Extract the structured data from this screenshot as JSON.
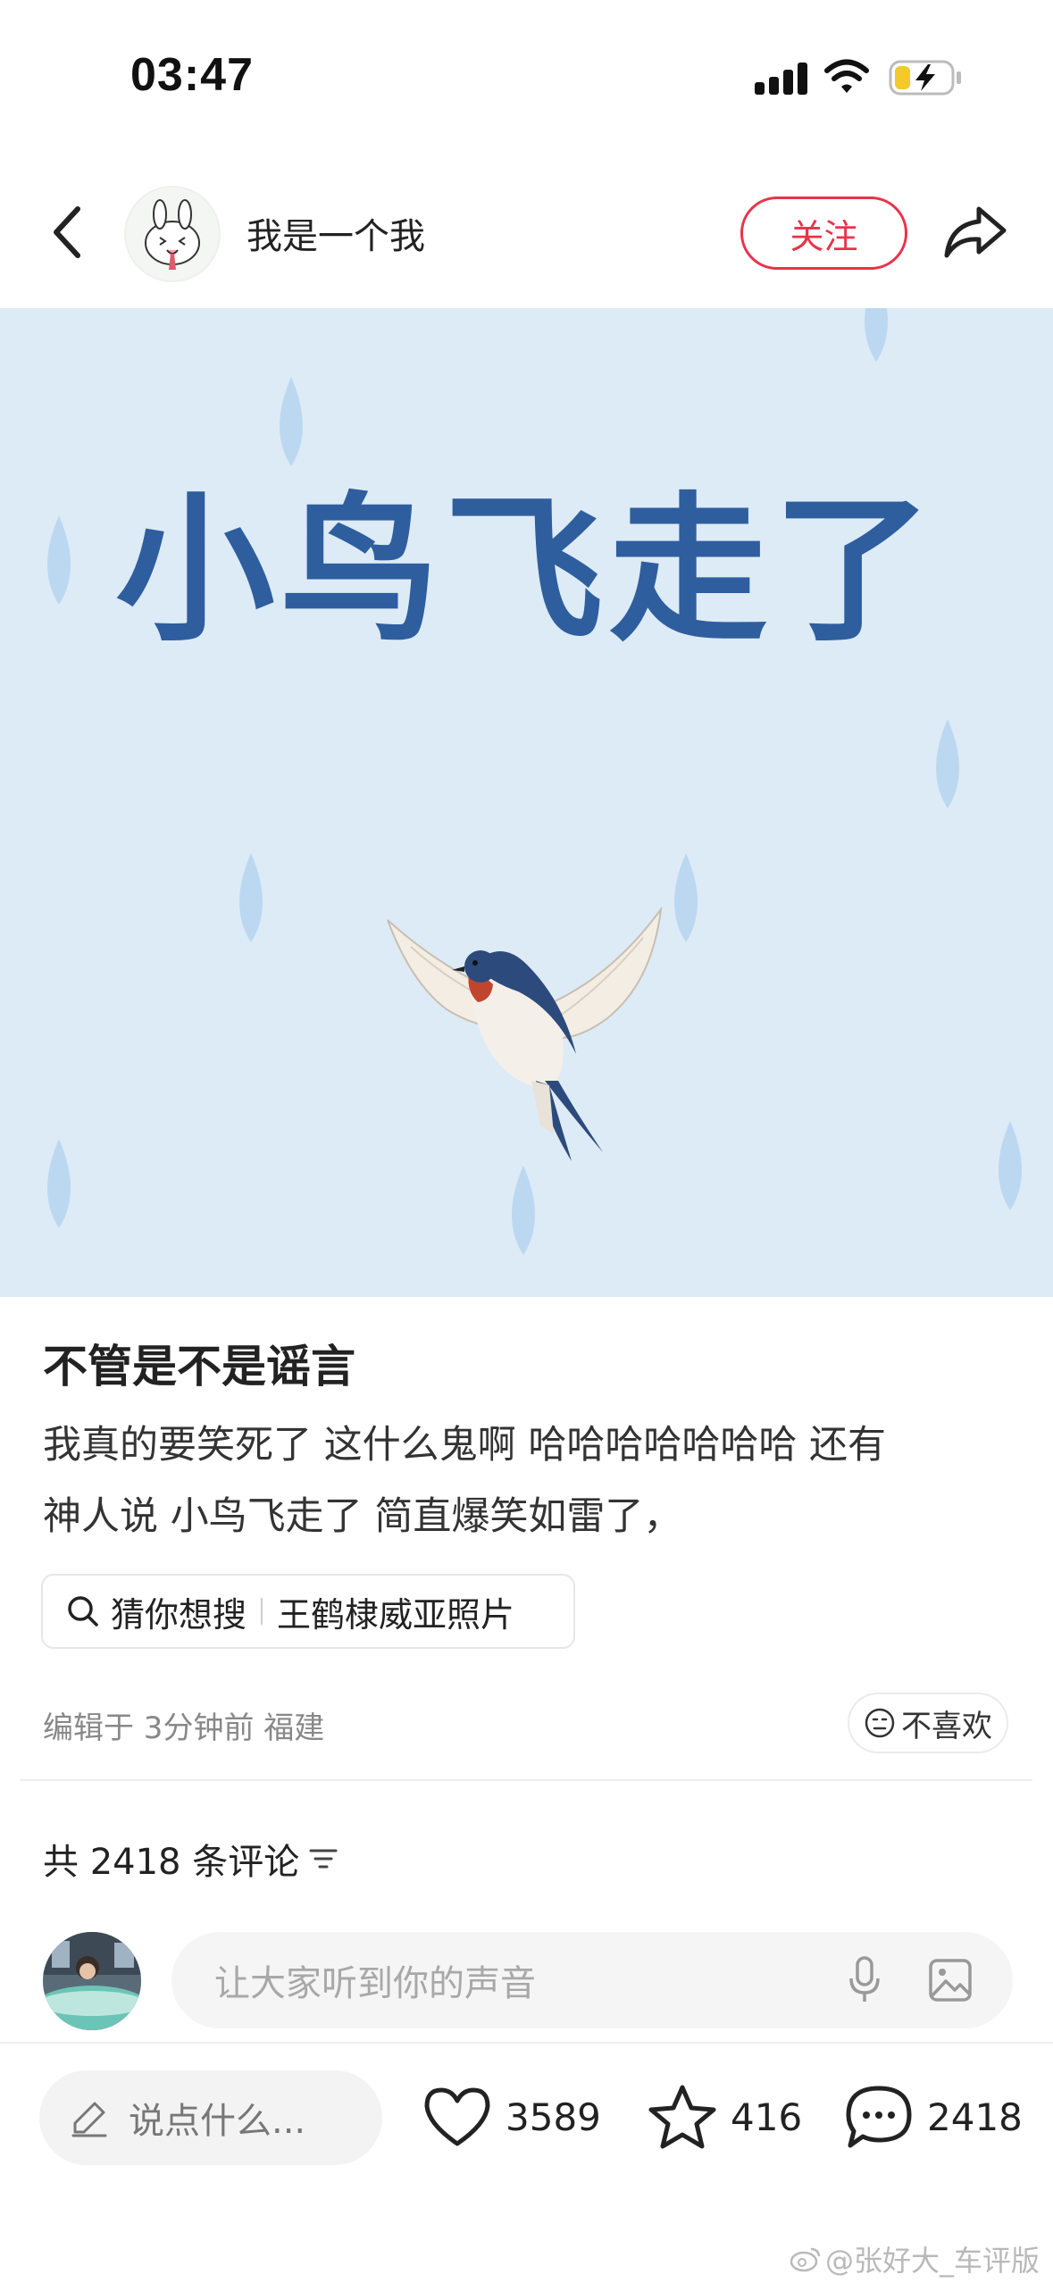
{
  "status_bar": {
    "time": "03:47",
    "icons": [
      "cellular-signal-icon",
      "wifi-icon",
      "battery-charging-icon"
    ]
  },
  "header": {
    "author_name": "我是一个我",
    "follow_label": "关注",
    "icons": [
      "back-arrow-icon",
      "share-icon"
    ],
    "accent_color": "#e8334a"
  },
  "post_image": {
    "overlay_text": "小鸟飞走了",
    "background_color": "#ddebf7",
    "text_color": "#2f5e9e",
    "picture": "swallow-bird"
  },
  "post": {
    "title": "不管是不是谣言",
    "body_line_1": "我真的要笑死了 这什么鬼啊 哈哈哈哈哈哈哈 还有",
    "body_line_2": "神人说 小鸟飞走了 简直爆笑如雷了，",
    "search_prefix": "猜你想搜",
    "search_term": "王鹤棣威亚照片",
    "meta": "编辑于 3分钟前 福建",
    "dislike_label": "不喜欢"
  },
  "comments": {
    "count_label": "共 2418 条评论",
    "input_placeholder": "让大家听到你的声音"
  },
  "bottom_bar": {
    "say_label": "说点什么...",
    "likes": "3589",
    "favorites": "416",
    "comments": "2418"
  },
  "watermark": "@张好大_车评版"
}
